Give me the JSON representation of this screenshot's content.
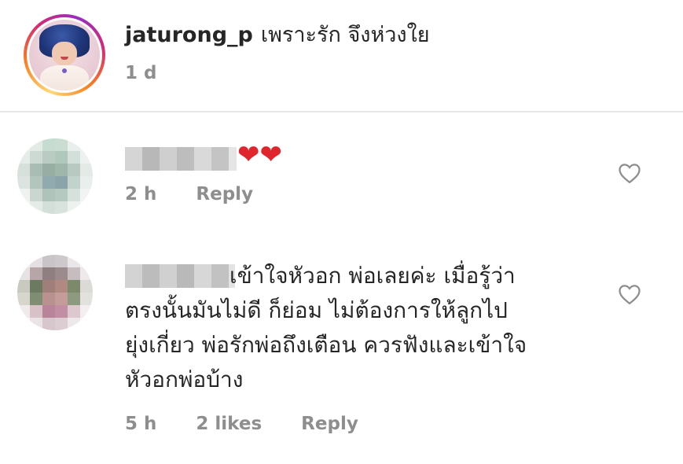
{
  "post": {
    "username": "jaturong_p",
    "caption": "เพราะรัก จึงห่วงใย",
    "time": "1 d"
  },
  "comments": [
    {
      "text_emoji": "❤❤",
      "time": "2 h",
      "reply_label": "Reply",
      "emoji_color": "#e0252c"
    },
    {
      "text_lines": [
        "เข้าใจหัวอก พ่อเลยค่ะ เมื่อรู้ว่า",
        "ตรงนั้นมันไม่ดี ก็ย่อม ไม่ต้องการให้ลูกไป",
        "ยุ่งเกี่ยว พ่อรักพ่อถึงเตือน ควรฟังและเข้าใจ",
        "หัวอกพ่อบ้าง"
      ],
      "time": "5 h",
      "likes": "2 likes",
      "reply_label": "Reply"
    }
  ],
  "icons": {
    "avatar_ring": "instagram-story-ring",
    "like": "heart-outline-icon"
  }
}
